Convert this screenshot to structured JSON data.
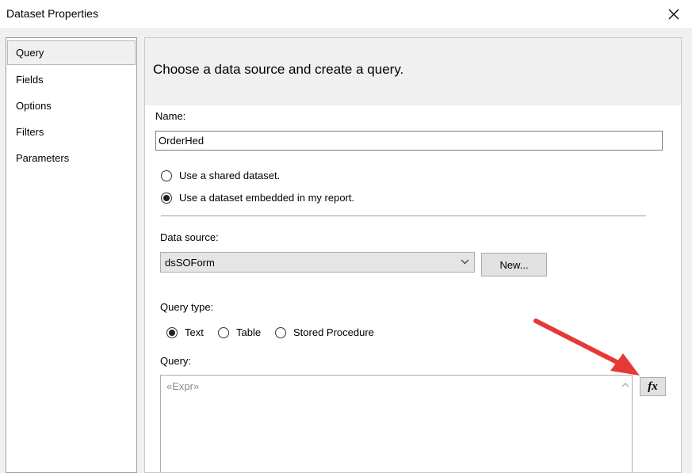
{
  "window": {
    "title": "Dataset Properties"
  },
  "nav": {
    "items": [
      "Query",
      "Fields",
      "Options",
      "Filters",
      "Parameters"
    ],
    "selected": 0
  },
  "panel": {
    "heading": "Choose a data source and create a query.",
    "name_label": "Name:",
    "name_value": "OrderHed",
    "shared_dataset_label": "Use a shared dataset.",
    "embedded_dataset_label": "Use a dataset embedded in my report.",
    "data_source_label": "Data source:",
    "data_source_value": "dsSOForm",
    "new_button_label": "New...",
    "query_type_label": "Query type:",
    "query_type_options": [
      "Text",
      "Table",
      "Stored Procedure"
    ],
    "query_label": "Query:",
    "query_placeholder": "«Expr»",
    "fx_label": "fx"
  },
  "colors": {
    "annotation_arrow": "#e53935"
  }
}
